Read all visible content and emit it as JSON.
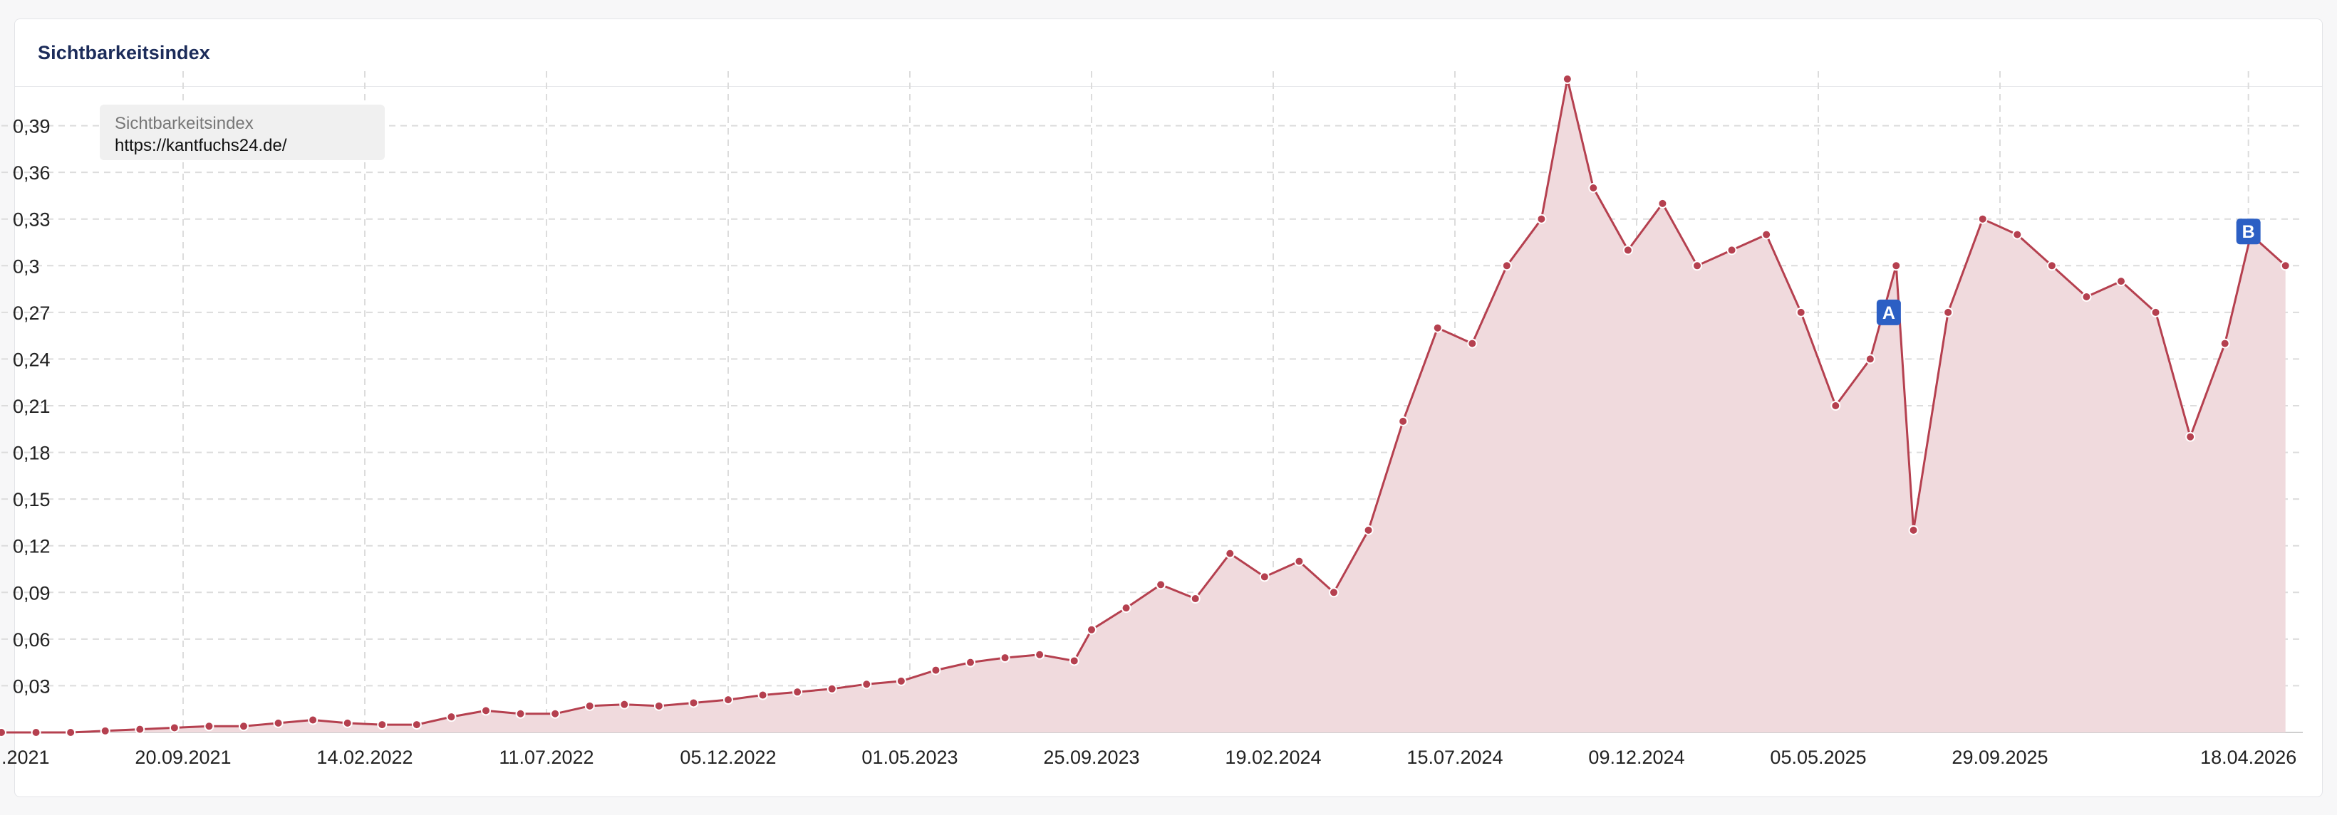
{
  "card": {
    "title": "Sichtbarkeitsindex"
  },
  "legend": {
    "title": "Sichtbarkeitsindex",
    "url": "https://kantfuchs24.de/"
  },
  "colors": {
    "line": "#b5404f",
    "fill": "#f0dadd",
    "marker": "#2c5fc4"
  },
  "chart_data": {
    "type": "area",
    "title": "Sichtbarkeitsindex",
    "xlabel": "",
    "ylabel": "",
    "ylim": [
      0,
      0.42
    ],
    "xlim": [
      "2021-04-26",
      "2026-06-01"
    ],
    "grid": true,
    "legend": "top-left",
    "yticks": [
      "0,03",
      "0,06",
      "0,09",
      "0,12",
      "0,15",
      "0,18",
      "0,21",
      "0,24",
      "0,27",
      "0,3",
      "0,33",
      "0,36",
      "0,39"
    ],
    "xticks": [
      {
        "date": "2021-04-26",
        "label": ".2021"
      },
      {
        "date": "2021-09-20",
        "label": "20.09.2021"
      },
      {
        "date": "2022-02-14",
        "label": "14.02.2022"
      },
      {
        "date": "2022-07-11",
        "label": "11.07.2022"
      },
      {
        "date": "2022-12-05",
        "label": "05.12.2022"
      },
      {
        "date": "2023-05-01",
        "label": "01.05.2023"
      },
      {
        "date": "2023-09-25",
        "label": "25.09.2023"
      },
      {
        "date": "2024-02-19",
        "label": "19.02.2024"
      },
      {
        "date": "2024-07-15",
        "label": "15.07.2024"
      },
      {
        "date": "2024-12-09",
        "label": "09.12.2024"
      },
      {
        "date": "2025-05-05",
        "label": "05.05.2025"
      },
      {
        "date": "2025-09-29",
        "label": "29.09.2025"
      },
      {
        "date": "2026-04-18",
        "label": "18.04.2026"
      }
    ],
    "series": [
      {
        "name": "https://kantfuchs24.de/",
        "points": [
          [
            "2021-04-26",
            0.0
          ],
          [
            "2021-05-24",
            0.0
          ],
          [
            "2021-06-21",
            0.0
          ],
          [
            "2021-07-19",
            0.001
          ],
          [
            "2021-08-16",
            0.002
          ],
          [
            "2021-09-13",
            0.003
          ],
          [
            "2021-10-11",
            0.004
          ],
          [
            "2021-11-08",
            0.004
          ],
          [
            "2021-12-06",
            0.006
          ],
          [
            "2022-01-03",
            0.008
          ],
          [
            "2022-01-31",
            0.006
          ],
          [
            "2022-02-28",
            0.005
          ],
          [
            "2022-03-28",
            0.005
          ],
          [
            "2022-04-25",
            0.01
          ],
          [
            "2022-05-23",
            0.014
          ],
          [
            "2022-06-20",
            0.012
          ],
          [
            "2022-07-18",
            0.012
          ],
          [
            "2022-08-15",
            0.017
          ],
          [
            "2022-09-12",
            0.018
          ],
          [
            "2022-10-10",
            0.017
          ],
          [
            "2022-11-07",
            0.019
          ],
          [
            "2022-12-05",
            0.021
          ],
          [
            "2023-01-02",
            0.024
          ],
          [
            "2023-01-30",
            0.026
          ],
          [
            "2023-02-27",
            0.028
          ],
          [
            "2023-03-27",
            0.031
          ],
          [
            "2023-04-24",
            0.033
          ],
          [
            "2023-05-22",
            0.04
          ],
          [
            "2023-06-19",
            0.045
          ],
          [
            "2023-07-17",
            0.048
          ],
          [
            "2023-08-14",
            0.05
          ],
          [
            "2023-09-11",
            0.046
          ],
          [
            "2023-09-25",
            0.066
          ],
          [
            "2023-10-23",
            0.08
          ],
          [
            "2023-11-20",
            0.095
          ],
          [
            "2023-12-18",
            0.086
          ],
          [
            "2024-01-15",
            0.115
          ],
          [
            "2024-02-12",
            0.1
          ],
          [
            "2024-03-11",
            0.11
          ],
          [
            "2024-04-08",
            0.09
          ],
          [
            "2024-05-06",
            0.13
          ],
          [
            "2024-06-03",
            0.2
          ],
          [
            "2024-07-01",
            0.26
          ],
          [
            "2024-07-29",
            0.25
          ],
          [
            "2024-08-26",
            0.3
          ],
          [
            "2024-09-23",
            0.33
          ],
          [
            "2024-10-14",
            0.42
          ],
          [
            "2024-11-04",
            0.35
          ],
          [
            "2024-12-02",
            0.31
          ],
          [
            "2024-12-30",
            0.34
          ],
          [
            "2025-01-27",
            0.3
          ],
          [
            "2025-02-24",
            0.31
          ],
          [
            "2025-03-24",
            0.32
          ],
          [
            "2025-04-21",
            0.27
          ],
          [
            "2025-05-19",
            0.21
          ],
          [
            "2025-06-16",
            0.24
          ],
          [
            "2025-07-07",
            0.3
          ],
          [
            "2025-07-21",
            0.13
          ],
          [
            "2025-08-18",
            0.27
          ],
          [
            "2025-09-15",
            0.33
          ],
          [
            "2025-10-13",
            0.32
          ],
          [
            "2025-11-10",
            0.3
          ],
          [
            "2025-12-08",
            0.28
          ],
          [
            "2026-01-05",
            0.29
          ],
          [
            "2026-02-02",
            0.27
          ],
          [
            "2026-03-02",
            0.19
          ],
          [
            "2026-03-30",
            0.25
          ],
          [
            "2026-04-20",
            0.32
          ],
          [
            "2026-05-18",
            0.3
          ]
        ]
      }
    ],
    "annotations": [
      {
        "label": "A",
        "date": "2025-07-01",
        "y": 0.27
      },
      {
        "label": "B",
        "date": "2026-04-18",
        "y": 0.322
      }
    ]
  }
}
